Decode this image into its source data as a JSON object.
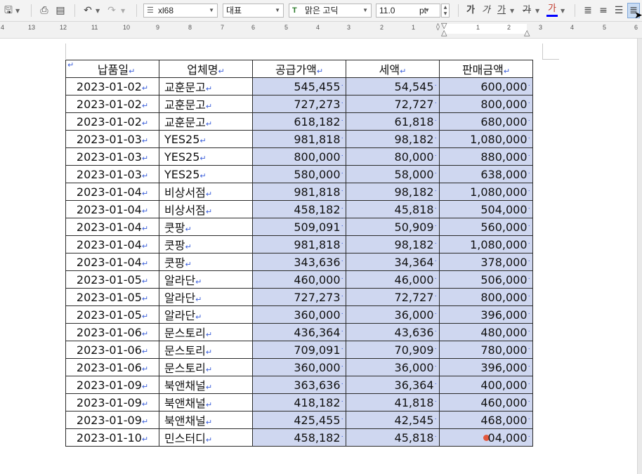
{
  "toolbar": {
    "style_value": "xl68",
    "style_language": "대표",
    "font_name": "맑은 고딕",
    "font_size": "11.0",
    "font_unit": "pt",
    "bold_label": "가",
    "italic_label": "가",
    "underline_label": "가",
    "strike_label": "가",
    "color_label": "가",
    "color_accent": "#0000ff"
  },
  "ruler": {
    "numbers": [
      "4",
      "13",
      "12",
      "11",
      "10",
      "9",
      "8",
      "7",
      "6",
      "5",
      "4",
      "3",
      "2",
      "1",
      "1",
      "2",
      "3",
      "4",
      "5",
      "6"
    ]
  },
  "table": {
    "headers": [
      "납품일",
      "업체명",
      "공급가액",
      "세액",
      "판매금액"
    ],
    "rows": [
      [
        "2023-01-02",
        "교훈문고",
        "545,455",
        "54,545",
        "600,000"
      ],
      [
        "2023-01-02",
        "교훈문고",
        "727,273",
        "72,727",
        "800,000"
      ],
      [
        "2023-01-02",
        "교훈문고",
        "618,182",
        "61,818",
        "680,000"
      ],
      [
        "2023-01-03",
        "YES25",
        "981,818",
        "98,182",
        "1,080,000"
      ],
      [
        "2023-01-03",
        "YES25",
        "800,000",
        "80,000",
        "880,000"
      ],
      [
        "2023-01-03",
        "YES25",
        "580,000",
        "58,000",
        "638,000"
      ],
      [
        "2023-01-04",
        "비상서점",
        "981,818",
        "98,182",
        "1,080,000"
      ],
      [
        "2023-01-04",
        "비상서점",
        "458,182",
        "45,818",
        "504,000"
      ],
      [
        "2023-01-04",
        "쿳팡",
        "509,091",
        "50,909",
        "560,000"
      ],
      [
        "2023-01-04",
        "쿳팡",
        "981,818",
        "98,182",
        "1,080,000"
      ],
      [
        "2023-01-04",
        "쿳팡",
        "343,636",
        "34,364",
        "378,000"
      ],
      [
        "2023-01-05",
        "알라단",
        "460,000",
        "46,000",
        "506,000"
      ],
      [
        "2023-01-05",
        "알라단",
        "727,273",
        "72,727",
        "800,000"
      ],
      [
        "2023-01-05",
        "알라단",
        "360,000",
        "36,000",
        "396,000"
      ],
      [
        "2023-01-06",
        "문스토리",
        "436,364",
        "43,636",
        "480,000"
      ],
      [
        "2023-01-06",
        "문스토리",
        "709,091",
        "70,909",
        "780,000"
      ],
      [
        "2023-01-06",
        "문스토리",
        "360,000",
        "36,000",
        "396,000"
      ],
      [
        "2023-01-09",
        "북앤채널",
        "363,636",
        "36,364",
        "400,000"
      ],
      [
        "2023-01-09",
        "북앤채널",
        "418,182",
        "41,818",
        "460,000"
      ],
      [
        "2023-01-09",
        "북앤채널",
        "425,455",
        "42,545",
        "468,000"
      ],
      [
        "2023-01-10",
        "민스터디",
        "458,182",
        "45,818",
        "04,000"
      ]
    ],
    "selection_color": "#cfd7f0"
  }
}
